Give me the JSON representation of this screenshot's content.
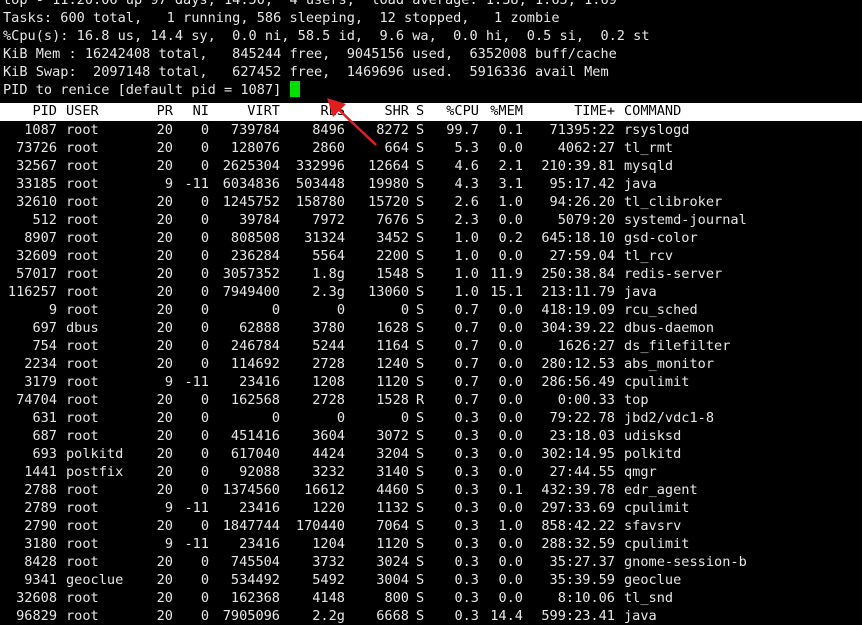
{
  "summary": {
    "uptime_line": "top - 11:20:06 up 97 days, 14:50,  4 users,  load average: 1.38, 1.65, 1.69",
    "tasks_line": "Tasks: 600 total,   1 running, 586 sleeping,  12 stopped,   1 zombie",
    "cpu_line": "%Cpu(s): 16.8 us, 14.4 sy,  0.0 ni, 58.5 id,  9.6 wa,  0.0 hi,  0.5 si,  0.2 st",
    "mem_line": "KiB Mem : 16242408 total,   845244 free,  9045156 used,  6352008 buff/cache",
    "swap_line": "KiB Swap:  2097148 total,   627452 free,  1469696 used.  5916336 avail Mem",
    "prompt_line": "PID to renice [default pid = 1087] "
  },
  "columns": {
    "pid": "PID",
    "user": "USER",
    "pr": "PR",
    "ni": "NI",
    "virt": "VIRT",
    "res": "RES",
    "shr": "SHR",
    "s": "S",
    "cpu": "%CPU",
    "mem": "%MEM",
    "time": "TIME+",
    "command": "COMMAND"
  },
  "processes": [
    [
      "1087",
      "root",
      "20",
      "0",
      "739784",
      "8496",
      "8272",
      "S",
      "99.7",
      "0.1",
      "71395:22",
      "rsyslogd"
    ],
    [
      "73726",
      "root",
      "20",
      "0",
      "128076",
      "2860",
      "664",
      "S",
      "5.3",
      "0.0",
      "4062:27",
      "tl_rmt"
    ],
    [
      "32567",
      "root",
      "20",
      "0",
      "2625304",
      "332996",
      "12664",
      "S",
      "4.6",
      "2.1",
      "210:39.81",
      "mysqld"
    ],
    [
      "33185",
      "root",
      "9",
      "-11",
      "6034836",
      "503448",
      "19980",
      "S",
      "4.3",
      "3.1",
      "95:17.42",
      "java"
    ],
    [
      "32610",
      "root",
      "20",
      "0",
      "1245752",
      "158780",
      "15720",
      "S",
      "2.6",
      "1.0",
      "94:26.20",
      "tl_clibroker"
    ],
    [
      "512",
      "root",
      "20",
      "0",
      "39784",
      "7972",
      "7676",
      "S",
      "2.3",
      "0.0",
      "5079:20",
      "systemd-journal"
    ],
    [
      "8907",
      "root",
      "20",
      "0",
      "808508",
      "31324",
      "3452",
      "S",
      "1.0",
      "0.2",
      "645:18.10",
      "gsd-color"
    ],
    [
      "32609",
      "root",
      "20",
      "0",
      "236284",
      "5564",
      "2200",
      "S",
      "1.0",
      "0.0",
      "27:59.04",
      "tl_rcv"
    ],
    [
      "57017",
      "root",
      "20",
      "0",
      "3057352",
      "1.8g",
      "1548",
      "S",
      "1.0",
      "11.9",
      "250:38.84",
      "redis-server"
    ],
    [
      "116257",
      "root",
      "20",
      "0",
      "7949400",
      "2.3g",
      "13060",
      "S",
      "1.0",
      "15.1",
      "213:11.79",
      "java"
    ],
    [
      "9",
      "root",
      "20",
      "0",
      "0",
      "0",
      "0",
      "S",
      "0.7",
      "0.0",
      "418:19.09",
      "rcu_sched"
    ],
    [
      "697",
      "dbus",
      "20",
      "0",
      "62888",
      "3780",
      "1628",
      "S",
      "0.7",
      "0.0",
      "304:39.22",
      "dbus-daemon"
    ],
    [
      "754",
      "root",
      "20",
      "0",
      "246784",
      "5244",
      "1164",
      "S",
      "0.7",
      "0.0",
      "1626:27",
      "ds_filefilter"
    ],
    [
      "2234",
      "root",
      "20",
      "0",
      "114692",
      "2728",
      "1240",
      "S",
      "0.7",
      "0.0",
      "280:12.53",
      "abs_monitor"
    ],
    [
      "3179",
      "root",
      "9",
      "-11",
      "23416",
      "1208",
      "1120",
      "S",
      "0.7",
      "0.0",
      "286:56.49",
      "cpulimit"
    ],
    [
      "74704",
      "root",
      "20",
      "0",
      "162568",
      "2728",
      "1528",
      "R",
      "0.7",
      "0.0",
      "0:00.33",
      "top"
    ],
    [
      "631",
      "root",
      "20",
      "0",
      "0",
      "0",
      "0",
      "S",
      "0.3",
      "0.0",
      "79:22.78",
      "jbd2/vdc1-8"
    ],
    [
      "687",
      "root",
      "20",
      "0",
      "451416",
      "3604",
      "3072",
      "S",
      "0.3",
      "0.0",
      "23:18.03",
      "udisksd"
    ],
    [
      "693",
      "polkitd",
      "20",
      "0",
      "617040",
      "4424",
      "3204",
      "S",
      "0.3",
      "0.0",
      "302:14.95",
      "polkitd"
    ],
    [
      "1441",
      "postfix",
      "20",
      "0",
      "92088",
      "3232",
      "3140",
      "S",
      "0.3",
      "0.0",
      "27:44.55",
      "qmgr"
    ],
    [
      "2788",
      "root",
      "20",
      "0",
      "1374560",
      "16612",
      "4460",
      "S",
      "0.3",
      "0.1",
      "432:39.78",
      "edr_agent"
    ],
    [
      "2789",
      "root",
      "9",
      "-11",
      "23416",
      "1220",
      "1132",
      "S",
      "0.3",
      "0.0",
      "297:33.69",
      "cpulimit"
    ],
    [
      "2790",
      "root",
      "20",
      "0",
      "1847744",
      "170440",
      "7064",
      "S",
      "0.3",
      "1.0",
      "858:42.22",
      "sfavsrv"
    ],
    [
      "3180",
      "root",
      "9",
      "-11",
      "23416",
      "1204",
      "1120",
      "S",
      "0.3",
      "0.0",
      "288:32.59",
      "cpulimit"
    ],
    [
      "8428",
      "root",
      "20",
      "0",
      "745504",
      "3732",
      "3024",
      "S",
      "0.3",
      "0.0",
      "35:27.37",
      "gnome-session-b"
    ],
    [
      "9341",
      "geoclue",
      "20",
      "0",
      "534492",
      "5492",
      "3004",
      "S",
      "0.3",
      "0.0",
      "35:39.59",
      "geoclue"
    ],
    [
      "32608",
      "root",
      "20",
      "0",
      "162368",
      "4148",
      "800",
      "S",
      "0.3",
      "0.0",
      "8:10.06",
      "tl_snd"
    ],
    [
      "96829",
      "root",
      "20",
      "0",
      "7905096",
      "2.2g",
      "6668",
      "S",
      "0.3",
      "14.4",
      "599:23.41",
      "java"
    ]
  ],
  "colors": {
    "background": "#000000",
    "foreground": "#e6e6e6",
    "header_bg": "#ffffff",
    "header_fg": "#000000",
    "cursor": "#00e000",
    "annotation_arrow": "#e02020"
  },
  "icons": {
    "annotation": "red-arrow-icon",
    "cursor": "block-cursor-icon"
  }
}
